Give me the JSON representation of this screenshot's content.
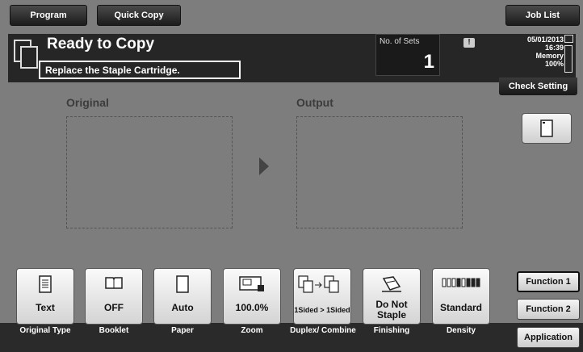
{
  "top_tabs": {
    "program": "Program",
    "quick_copy": "Quick Copy",
    "job_list": "Job List"
  },
  "status": {
    "title": "Ready to Copy",
    "message": "Replace the Staple Cartridge.",
    "sets_label": "No. of Sets",
    "sets_value": "1",
    "date": "05/01/2013",
    "time": "16:39",
    "memory_label": "Memory",
    "memory_value": "100%",
    "check_setting": "Check Setting"
  },
  "preview": {
    "original_label": "Original",
    "output_label": "Output"
  },
  "functions": [
    {
      "value": "Text",
      "caption": "Original Type",
      "icon": "document-lines-icon"
    },
    {
      "value": "OFF",
      "caption": "Booklet",
      "icon": "booklet-icon"
    },
    {
      "value": "Auto",
      "caption": "Paper",
      "icon": "paper-icon"
    },
    {
      "value": "100.0%",
      "caption": "Zoom",
      "icon": "zoom-icon"
    },
    {
      "value": "1Sided > 1Sided",
      "caption": "Duplex/ Combine",
      "icon": "duplex-icon"
    },
    {
      "value": "Do Not Staple",
      "caption": "Finishing",
      "icon": "staple-icon"
    },
    {
      "value": "Standard",
      "caption": "Density",
      "icon": "density-icon"
    }
  ],
  "right_tabs": {
    "function1": "Function 1",
    "function2": "Function 2",
    "application": "Application"
  },
  "colors": {
    "background": "#7d7d7d",
    "panel": "#262626",
    "button": "#e6e6e6"
  }
}
